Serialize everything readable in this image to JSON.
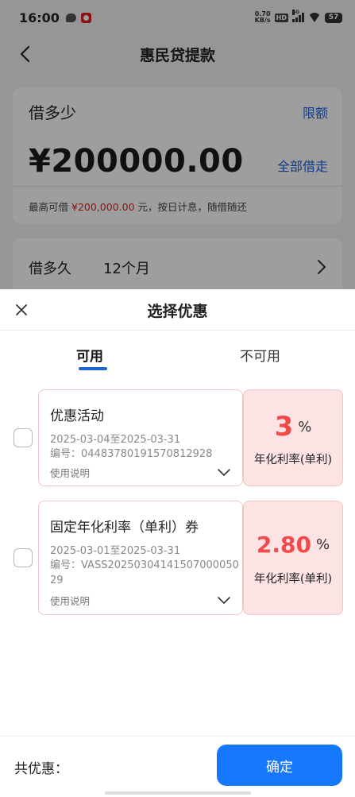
{
  "status_bar": {
    "time": "16:00",
    "net_speed_value": "0.70",
    "net_speed_unit": "KB/s",
    "hd_badge": "HD",
    "network_label": "5G",
    "battery": "57"
  },
  "header": {
    "title": "惠民贷提款"
  },
  "amount_card": {
    "label": "借多少",
    "limit_link": "限额",
    "amount": "¥200000.00",
    "borrow_all": "全部借走",
    "hint_prefix": "最高可借",
    "hint_amount": "¥200,000.00",
    "hint_suffix": "元，按日计息，随借随还"
  },
  "term_card": {
    "label": "借多久",
    "value": "12个月"
  },
  "sheet": {
    "title": "选择优惠",
    "tabs": [
      {
        "label": "可用",
        "active": true
      },
      {
        "label": "不可用",
        "active": false
      }
    ],
    "coupons": [
      {
        "name": "优惠活动",
        "dates": "2025-03-04至2025-03-31",
        "code": "编号：04483780191570812928",
        "usage": "使用说明",
        "rate": "3",
        "unit": "%",
        "rate_label": "年化利率(单利)"
      },
      {
        "name": "固定年化利率（单利）券",
        "dates": "2025-03-01至2025-03-31",
        "code": "编号：VASS2025030414150700005029",
        "usage": "使用说明",
        "rate": "2.80",
        "unit": "%",
        "rate_label": "年化利率(单利)"
      }
    ],
    "footer": {
      "total_label": "共优惠：",
      "confirm_label": "确定"
    }
  },
  "colors": {
    "accent_blue": "#1677ff",
    "link_blue": "#1e63d8",
    "rate_red": "#f24a4a",
    "coupon_bg": "#fde3e3"
  }
}
